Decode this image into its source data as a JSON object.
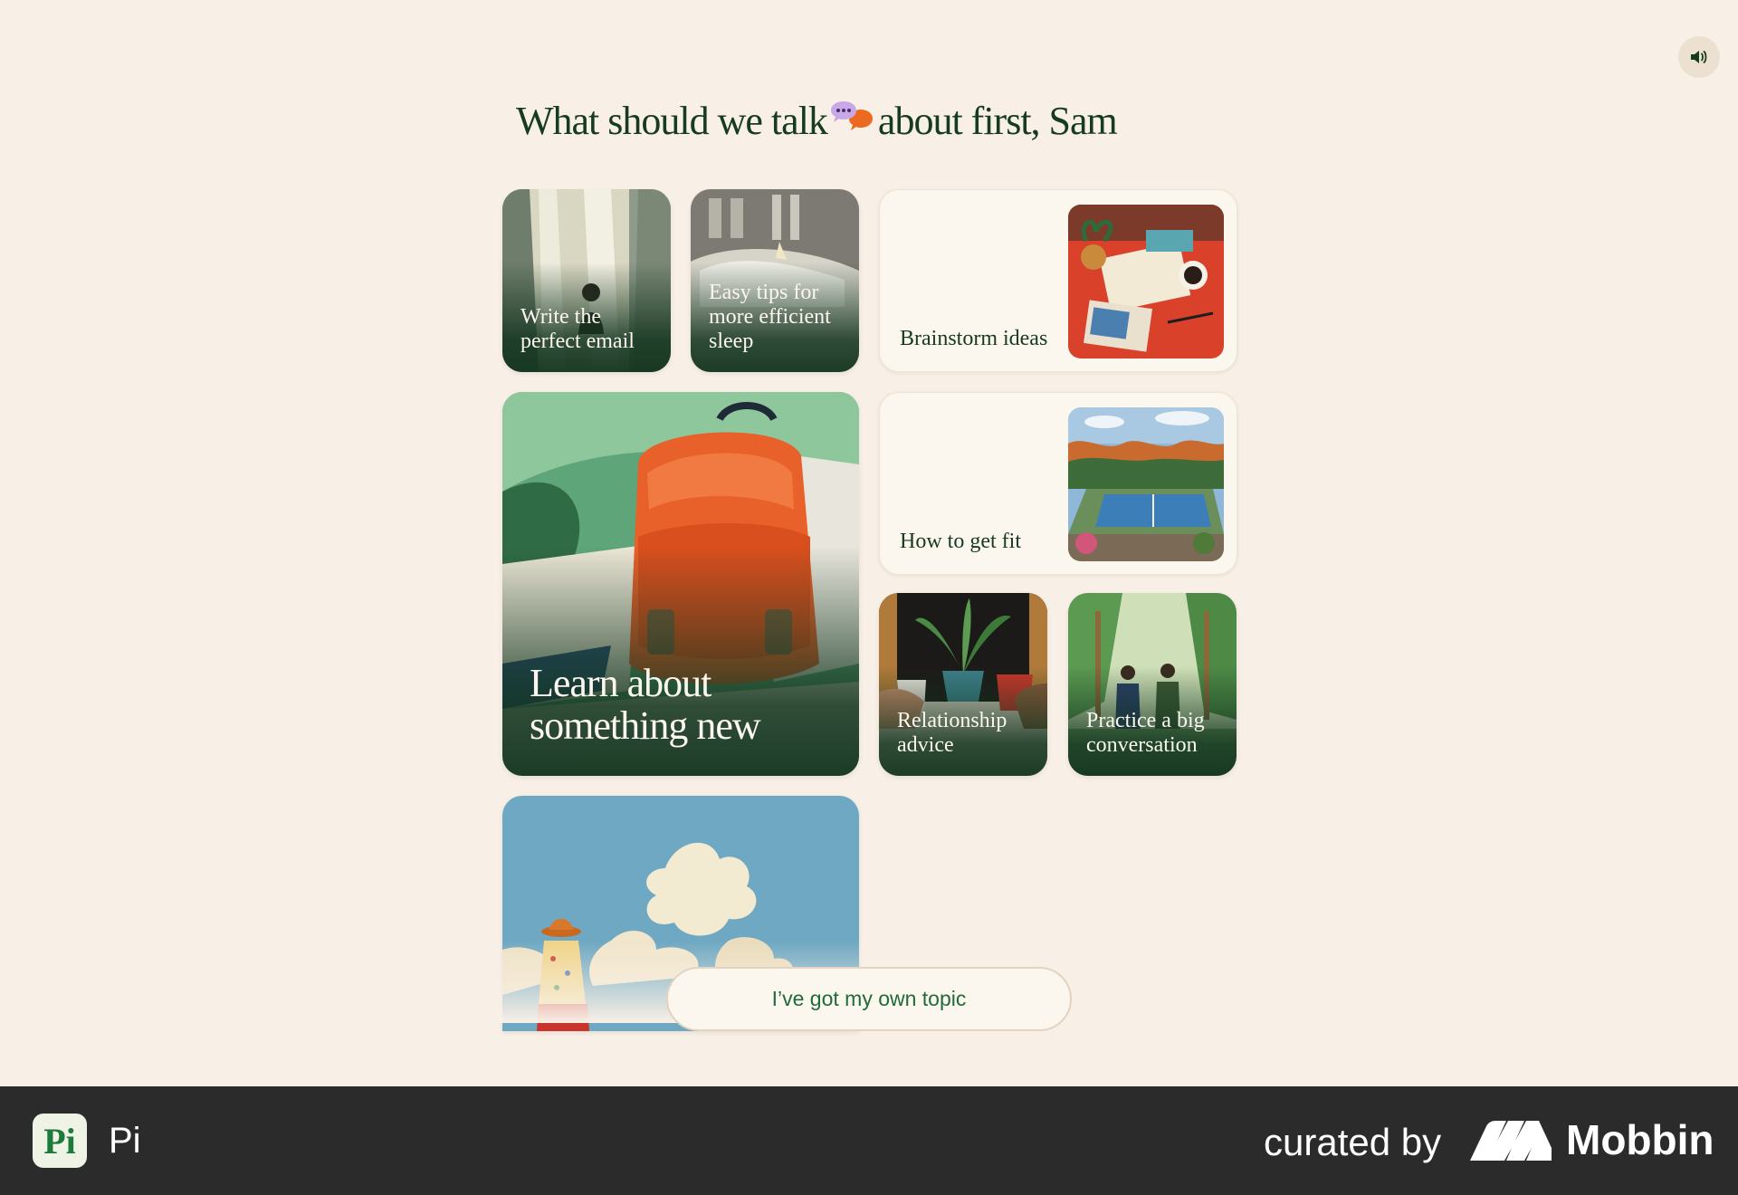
{
  "heading": {
    "before": "What should we talk",
    "after": "about first, Sam",
    "emoji_icon": "speech-bubbles-icon"
  },
  "sound_button": {
    "icon": "speaker-icon"
  },
  "cards": [
    {
      "label": "Write the perfect email"
    },
    {
      "label": "Easy tips for more efficient sleep"
    },
    {
      "label": "Brainstorm ideas"
    },
    {
      "label": "Learn about something new"
    },
    {
      "label": "How to get fit"
    },
    {
      "label": "Relationship advice"
    },
    {
      "label": "Practice a big conversation"
    }
  ],
  "own_topic_button": {
    "label": "I’ve got my own topic"
  },
  "footer": {
    "app_icon_text": "Pi",
    "app_name": "Pi",
    "curated_by": "curated by",
    "brand": "Mobbin"
  },
  "colors": {
    "background": "#f8f0e6",
    "heading": "#173b1f",
    "accent_green": "#1f6b3a",
    "footer": "#2b2b2b"
  }
}
